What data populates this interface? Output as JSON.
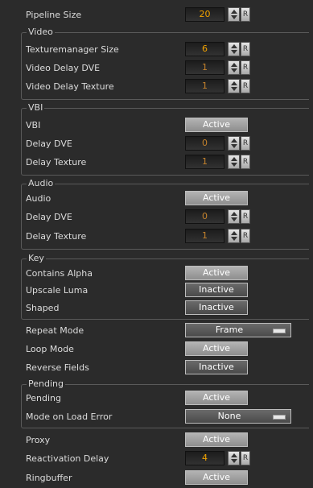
{
  "pipeline_size": {
    "label": "Pipeline Size",
    "value": "20",
    "reset": "R"
  },
  "video": {
    "title": "Video",
    "texturemanager_size": {
      "label": "Texturemanager Size",
      "value": "6",
      "reset": "R"
    },
    "delay_dve": {
      "label": "Video Delay DVE",
      "value": "1",
      "reset": "R"
    },
    "delay_texture": {
      "label": "Video Delay Texture",
      "value": "1",
      "reset": "R"
    }
  },
  "vbi": {
    "title": "VBI",
    "vbi": {
      "label": "VBI",
      "state": "Active"
    },
    "delay_dve": {
      "label": "Delay DVE",
      "value": "0",
      "reset": "R"
    },
    "delay_texture": {
      "label": "Delay Texture",
      "value": "1",
      "reset": "R"
    }
  },
  "audio": {
    "title": "Audio",
    "audio": {
      "label": "Audio",
      "state": "Active"
    },
    "delay_dve": {
      "label": "Delay DVE",
      "value": "0",
      "reset": "R"
    },
    "delay_texture": {
      "label": "Delay Texture",
      "value": "1",
      "reset": "R"
    }
  },
  "key": {
    "title": "Key",
    "contains_alpha": {
      "label": "Contains Alpha",
      "state": "Active"
    },
    "upscale_luma": {
      "label": "Upscale Luma",
      "state": "Inactive"
    },
    "shaped": {
      "label": "Shaped",
      "state": "Inactive"
    }
  },
  "repeat_mode": {
    "label": "Repeat Mode",
    "value": "Frame"
  },
  "loop_mode": {
    "label": "Loop Mode",
    "state": "Active"
  },
  "reverse_fields": {
    "label": "Reverse Fields",
    "state": "Inactive"
  },
  "pending": {
    "title": "Pending",
    "pending": {
      "label": "Pending",
      "state": "Active"
    },
    "mode_on_load_error": {
      "label": "Mode on Load Error",
      "value": "None"
    }
  },
  "proxy": {
    "label": "Proxy",
    "state": "Active"
  },
  "reactivation_delay": {
    "label": "Reactivation Delay",
    "value": "4",
    "reset": "R"
  },
  "ringbuffer": {
    "label": "Ringbuffer",
    "state": "Active"
  }
}
